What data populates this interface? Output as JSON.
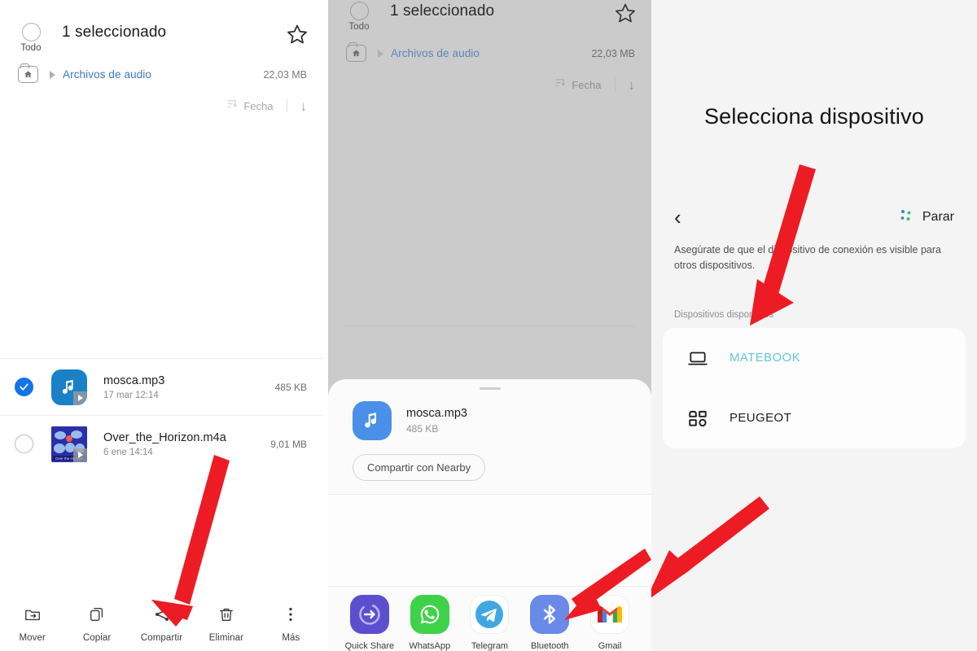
{
  "panel_file_manager": {
    "name": "file-manager-selection-screen",
    "header": {
      "select_all_label": "Todo",
      "selection_count": "1 seleccionado",
      "favorite_icon": "star-icon"
    },
    "breadcrumb": {
      "home_icon": "home-folder-icon",
      "path_label": "Archivos de audio",
      "total_size": "22,03 MB"
    },
    "sort_bar": {
      "sort_icon": "sort-icon",
      "sort_field": "Fecha",
      "direction_icon": "arrow-down-icon"
    },
    "files": [
      {
        "name": "mosca.mp3",
        "date": "17 mar 12:14",
        "size": "485 KB",
        "selected": true,
        "thumb": "audio-note-icon"
      },
      {
        "name": "Over_the_Horizon.m4a",
        "date": "6 ene 14:14",
        "size": "9,01 MB",
        "selected": false,
        "thumb": "album-art"
      }
    ],
    "toolbar": [
      {
        "label": "Mover",
        "icon": "move-folder-icon"
      },
      {
        "label": "Copiar",
        "icon": "copy-icon"
      },
      {
        "label": "Compartir",
        "icon": "share-icon"
      },
      {
        "label": "Eliminar",
        "icon": "trash-icon"
      },
      {
        "label": "Más",
        "icon": "more-vertical-icon"
      }
    ]
  },
  "panel_share_sheet": {
    "name": "share-sheet-screen",
    "header": {
      "select_all_label": "Todo",
      "selection_count": "1 seleccionado",
      "favorite_icon": "star-icon"
    },
    "breadcrumb": {
      "home_icon": "home-folder-icon",
      "path_label": "Archivos de audio",
      "total_size": "22,03 MB"
    },
    "sort_bar": {
      "sort_icon": "sort-icon",
      "sort_field": "Fecha",
      "direction_icon": "arrow-down-icon"
    },
    "sheet": {
      "file_name": "mosca.mp3",
      "file_size": "485 KB",
      "nearby_button": "Compartir con Nearby",
      "apps": [
        {
          "label": "Quick Share",
          "icon": "quick-share-icon",
          "color": "#5b4fcf"
        },
        {
          "label": "WhatsApp",
          "icon": "whatsapp-icon",
          "color": "#3ed24a"
        },
        {
          "label": "Telegram",
          "icon": "telegram-icon",
          "color": "#3fa3e0"
        },
        {
          "label": "Bluetooth",
          "icon": "bluetooth-icon",
          "color": "#6a8ae8"
        },
        {
          "label": "Gmail",
          "icon": "gmail-icon",
          "color": "#ffffff"
        }
      ]
    }
  },
  "panel_device_picker": {
    "name": "bluetooth-device-picker-screen",
    "title": "Selecciona dispositivo",
    "back_icon": "chevron-left-icon",
    "scan": {
      "icon": "scanning-dots-icon",
      "label": "Parar"
    },
    "hint": "Asegúrate de que el dispositivo de conexión es visible para otros dispositivos.",
    "available_label": "Dispositivos disponibles",
    "devices": [
      {
        "name": "MATEBOOK",
        "icon": "laptop-icon",
        "highlighted": true
      },
      {
        "name": "PEUGEOT",
        "icon": "car-grid-icon",
        "highlighted": false
      }
    ]
  },
  "annotations": {
    "accent_color": "#ed1c24",
    "arrows": [
      {
        "name": "arrow-to-compartir"
      },
      {
        "name": "arrow-to-bluetooth"
      },
      {
        "name": "arrow-to-matebook"
      },
      {
        "name": "arrow-to-bottom-right"
      }
    ]
  }
}
